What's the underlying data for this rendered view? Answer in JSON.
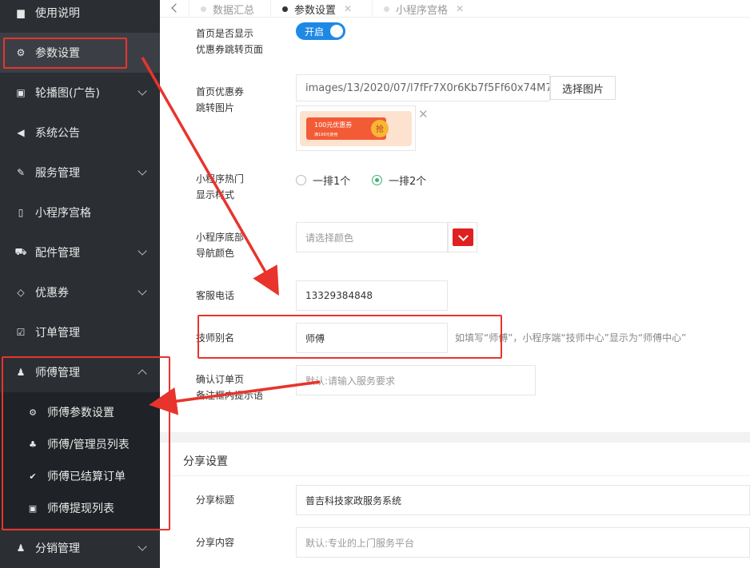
{
  "sidebar": {
    "items": [
      {
        "label": "使用说明",
        "icon": "book-icon"
      },
      {
        "label": "参数设置",
        "icon": "gear-icon"
      },
      {
        "label": "轮播图(广告)",
        "icon": "image-icon"
      },
      {
        "label": "系统公告",
        "icon": "megaphone-icon"
      },
      {
        "label": "服务管理",
        "icon": "wrench-icon"
      },
      {
        "label": "小程序宫格",
        "icon": "phone-icon"
      },
      {
        "label": "配件管理",
        "icon": "cart-icon"
      },
      {
        "label": "优惠券",
        "icon": "diamond-icon"
      },
      {
        "label": "订单管理",
        "icon": "checkbox-icon"
      },
      {
        "label": "师傅管理",
        "icon": "user-icon"
      },
      {
        "label": "分销管理",
        "icon": "users-plus-icon"
      }
    ],
    "submenu": [
      {
        "label": "师傅参数设置",
        "icon": "gear-icon"
      },
      {
        "label": "师傅/管理员列表",
        "icon": "users-icon"
      },
      {
        "label": "师傅已结算订单",
        "icon": "check-circle-icon"
      },
      {
        "label": "师傅提现列表",
        "icon": "money-icon"
      }
    ]
  },
  "tabs": [
    {
      "label": "数据汇总"
    },
    {
      "label": "参数设置",
      "close": "✕"
    },
    {
      "label": "小程序宫格",
      "close": "✕"
    }
  ],
  "form": {
    "coupon_jump": {
      "label_line1": "首页是否显示",
      "label_line2": "优惠券跳转页面",
      "switch_text": "开启",
      "enabled": true
    },
    "coupon_image": {
      "label_line1": "首页优惠券",
      "label_line2": "跳转图片",
      "value": "images/13/2020/07/l7fFr7X0r6Kb7f5Ff60x74M7",
      "button": "选择图片",
      "thumb_text": "100元优惠券",
      "thumb_sub": "满199元使用",
      "thumb_badge": "抢",
      "remove": "✕"
    },
    "hot_style": {
      "label_line1": "小程序热门",
      "label_line2": "显示样式",
      "options": [
        "一排1个",
        "一排2个"
      ],
      "selected": 1
    },
    "nav_color": {
      "label_line1": "小程序底部",
      "label_line2": "导航颜色",
      "placeholder": "请选择颜色",
      "color": "#e02020"
    },
    "phone": {
      "label": "客服电话",
      "value": "13329384848"
    },
    "alias": {
      "label": "技师别名",
      "value": "师傅",
      "hint": "如填写“师傅”，小程序端“技师中心”显示为“师傅中心”"
    },
    "remark": {
      "label_line1": "确认订单页",
      "label_line2": "备注框内提示语",
      "placeholder": "默认:请输入服务要求"
    }
  },
  "share": {
    "section_title": "分享设置",
    "title": {
      "label": "分享标题",
      "value": "普吉科技家政服务系统"
    },
    "content": {
      "label": "分享内容",
      "placeholder": "默认:专业的上门服务平台"
    }
  },
  "colors": {
    "annotation": "#e8342c",
    "switch": "#1e88e5",
    "sidebar": "#2b2e33"
  }
}
